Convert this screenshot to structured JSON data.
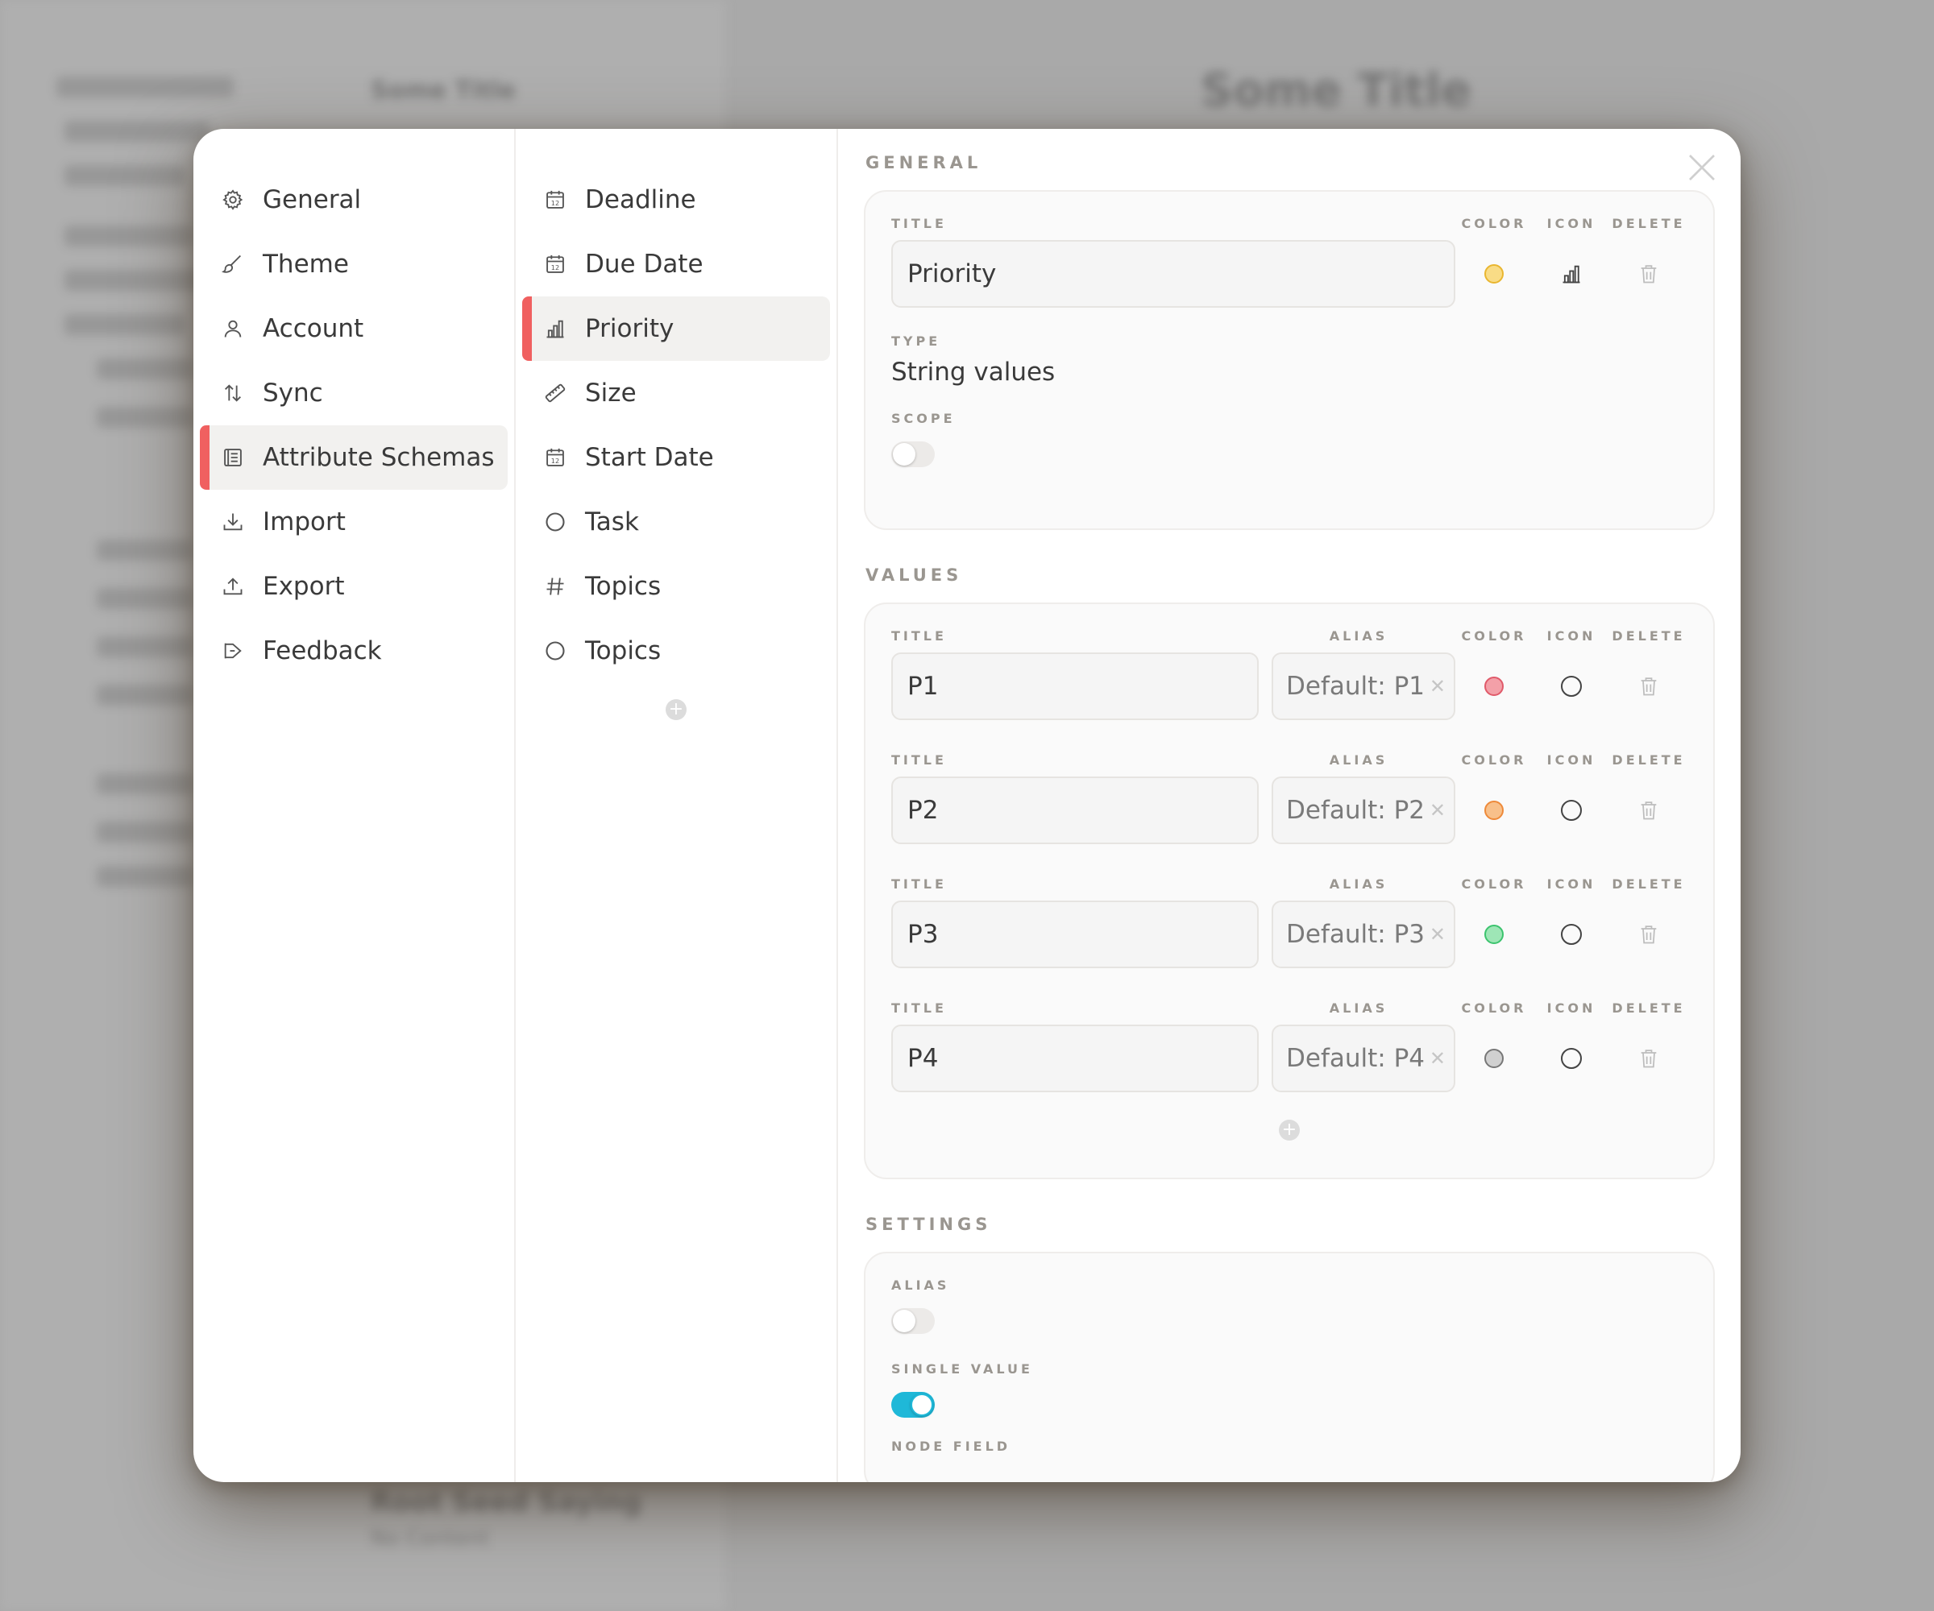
{
  "background": {
    "title": "Some Title",
    "side_title": "Some Title",
    "bottom_title": "Root Seed Saying",
    "bottom_sub": "No Content"
  },
  "nav": {
    "items": [
      {
        "label": "General",
        "icon": "gear-icon"
      },
      {
        "label": "Theme",
        "icon": "brush-icon"
      },
      {
        "label": "Account",
        "icon": "user-icon"
      },
      {
        "label": "Sync",
        "icon": "sync-arrows-icon"
      },
      {
        "label": "Attribute Schemas",
        "icon": "list-icon",
        "active": true
      },
      {
        "label": "Import",
        "icon": "download-icon"
      },
      {
        "label": "Export",
        "icon": "upload-icon"
      },
      {
        "label": "Feedback",
        "icon": "megaphone-icon"
      }
    ]
  },
  "schemas": {
    "items": [
      {
        "label": "Deadline",
        "icon": "calendar-icon"
      },
      {
        "label": "Due Date",
        "icon": "calendar-icon"
      },
      {
        "label": "Priority",
        "icon": "bar-chart-icon",
        "active": true
      },
      {
        "label": "Size",
        "icon": "ruler-icon"
      },
      {
        "label": "Start Date",
        "icon": "calendar-icon"
      },
      {
        "label": "Task",
        "icon": "circle-icon"
      },
      {
        "label": "Topics",
        "icon": "hash-icon"
      },
      {
        "label": "Topics",
        "icon": "circle-icon"
      }
    ],
    "add_label": "+"
  },
  "general": {
    "section_title": "GENERAL",
    "title_label": "TITLE",
    "color_label": "COLOR",
    "icon_label": "ICON",
    "delete_label": "DELETE",
    "title_value": "Priority",
    "color": "#f7d268",
    "type_label": "TYPE",
    "type_value": "String values",
    "scope_label": "SCOPE"
  },
  "values": {
    "section_title": "VALUES",
    "col_title": "TITLE",
    "col_alias": "ALIAS",
    "col_color": "COLOR",
    "col_icon": "ICON",
    "col_delete": "DELETE",
    "rows": [
      {
        "title": "P1",
        "alias_placeholder": "Default: P1",
        "color": "#f3a0a8",
        "border": "#e05a6a"
      },
      {
        "title": "P2",
        "alias_placeholder": "Default: P2",
        "color": "#f8c08a",
        "border": "#ee8a3a"
      },
      {
        "title": "P3",
        "alias_placeholder": "Default: P3",
        "color": "#9ee6b6",
        "border": "#3cc46e"
      },
      {
        "title": "P4",
        "alias_placeholder": "Default: P4",
        "color": "#d0d0d0",
        "border": "#777777"
      }
    ],
    "add_label": "+"
  },
  "settings": {
    "section_title": "SETTINGS",
    "alias_label": "ALIAS",
    "single_label": "SINGLE VALUE",
    "next_label": "NODE FIELD"
  }
}
